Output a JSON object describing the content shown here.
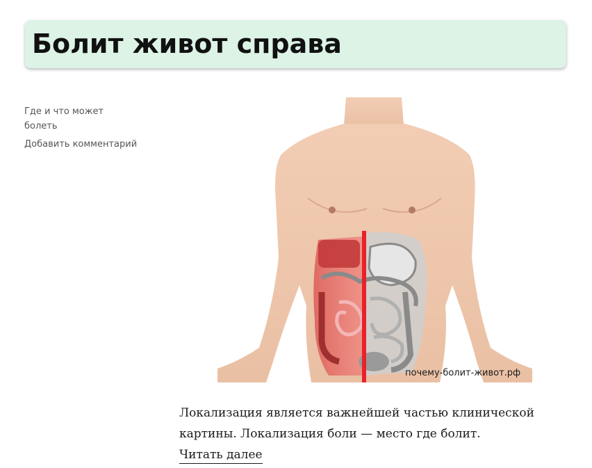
{
  "post": {
    "title": "Болит живот справа",
    "category_link": "Где и что может болеть",
    "comment_link": "Добавить комментарий",
    "image": {
      "alt_description": "abdomen-organs-illustration",
      "watermark": "почему-болит-живот.рф"
    },
    "excerpt": "Локализация является важнейшей частью клинической картины. Локализация боли — место где болит.",
    "read_more": "Читать далее"
  },
  "colors": {
    "title_background": "#dcf3e6",
    "title_text": "#111111",
    "meta_text": "#555555",
    "body_text": "#1a1a1a",
    "highlight_red": "#e8222a"
  }
}
